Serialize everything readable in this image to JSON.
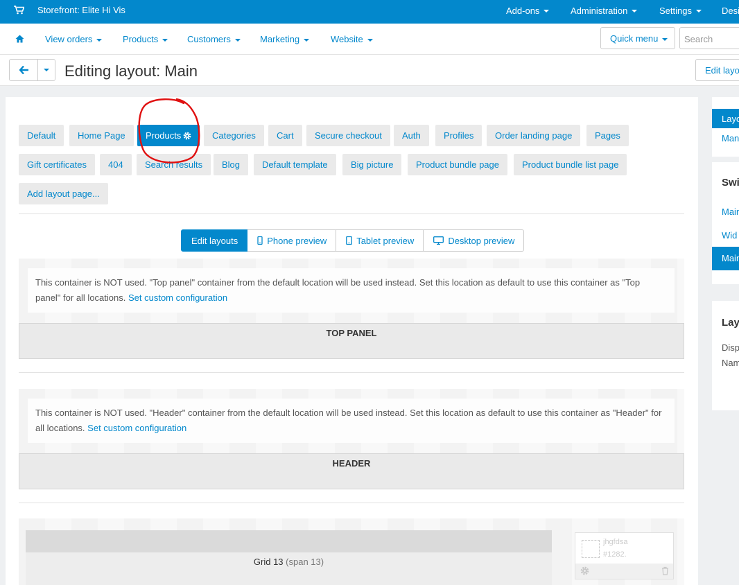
{
  "topbar": {
    "store_label": "Storefront: Elite Hi Vis",
    "menus": [
      "Add-ons",
      "Administration",
      "Settings",
      "Desi"
    ],
    "bg_color": "#0388cc"
  },
  "navbar": {
    "items": [
      "View orders",
      "Products",
      "Customers",
      "Marketing",
      "Website"
    ],
    "quick_menu_label": "Quick menu",
    "search_placeholder": "Search"
  },
  "titlebar": {
    "title": "Editing layout: Main",
    "edit_button": "Edit layo"
  },
  "layout_tabs": {
    "row1": [
      "Default",
      "Home Page",
      "Products",
      "Categories",
      "Cart",
      "Secure checkout",
      "Auth",
      "Profiles",
      "Order landing page",
      "Pages"
    ],
    "row2": [
      "Gift certificates",
      "404",
      "Search results",
      "Blog",
      "Default template",
      "Big picture",
      "Product bundle page",
      "Product bundle list page"
    ],
    "add_label": "Add layout page...",
    "active": "Products"
  },
  "preview_buttons": [
    "Edit layouts",
    "Phone preview",
    "Tablet preview",
    "Desktop preview"
  ],
  "containers": {
    "top_panel": {
      "notice": "This container is NOT used. \"Top panel\" container from the default location will be used instead. Set this location as default to use this container as \"Top panel\" for all locations.",
      "link": "Set custom configuration",
      "label": "TOP PANEL"
    },
    "header": {
      "notice": "This container is NOT used. \"Header\" container from the default location will be used instead. Set this location as default to use this container as \"Header\" for all locations.",
      "link": "Set custom configuration",
      "label": "HEADER"
    },
    "content": {
      "grid_label": "Grid 13",
      "grid_span": "(span 13)",
      "widget_name": "jhgfdsa",
      "widget_id": "#1282."
    }
  },
  "sidebar": {
    "tabs_active": "Layo",
    "tabs_item": "Man",
    "switch_heading": "Swi",
    "switch_items": [
      "Main",
      "Wid"
    ],
    "switch_active": "Main",
    "layout_heading": "Lay",
    "layout_lines": [
      "Disp",
      "Nam"
    ]
  },
  "colors": {
    "accent": "#0388cc",
    "annotation": "#e01010"
  }
}
